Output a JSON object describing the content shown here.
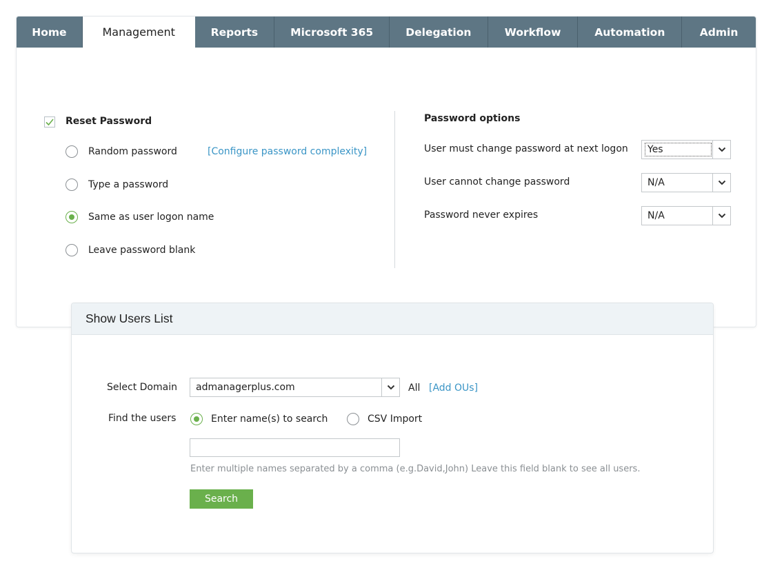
{
  "tabs": [
    {
      "label": "Home"
    },
    {
      "label": "Management"
    },
    {
      "label": "Reports"
    },
    {
      "label": "Microsoft 365"
    },
    {
      "label": "Delegation"
    },
    {
      "label": "Workflow"
    },
    {
      "label": "Automation"
    },
    {
      "label": "Admin"
    }
  ],
  "active_tab": "Management",
  "reset_password": {
    "label": "Reset Password",
    "checked": true,
    "options": [
      {
        "label": "Random password",
        "selected": false
      },
      {
        "label": "Type a password",
        "selected": false
      },
      {
        "label": "Same as user logon name",
        "selected": true
      },
      {
        "label": "Leave password blank",
        "selected": false
      }
    ],
    "configure_link": "[Configure password complexity]"
  },
  "password_options": {
    "title": "Password options",
    "rows": [
      {
        "label": "User must change password at next logon",
        "value": "Yes"
      },
      {
        "label": "User cannot change password",
        "value": "N/A"
      },
      {
        "label": "Password never expires",
        "value": "N/A"
      }
    ]
  },
  "users_popup": {
    "title": "Show Users List",
    "select_domain_label": "Select Domain",
    "domain_value": "admanagerplus.com",
    "all_label": "All",
    "add_ous_link": "[Add OUs]",
    "find_users_label": "Find the users",
    "find_options": [
      {
        "label": "Enter name(s) to search",
        "selected": true
      },
      {
        "label": "CSV Import",
        "selected": false
      }
    ],
    "names_input_value": "",
    "hint": "Enter multiple names separated by a comma (e.g.David,John) Leave this field blank to see all users.",
    "search_button": "Search"
  },
  "colors": {
    "tabbar": "#5e7684",
    "accent_green": "#6ab04c",
    "link_blue": "#3a95c6"
  }
}
